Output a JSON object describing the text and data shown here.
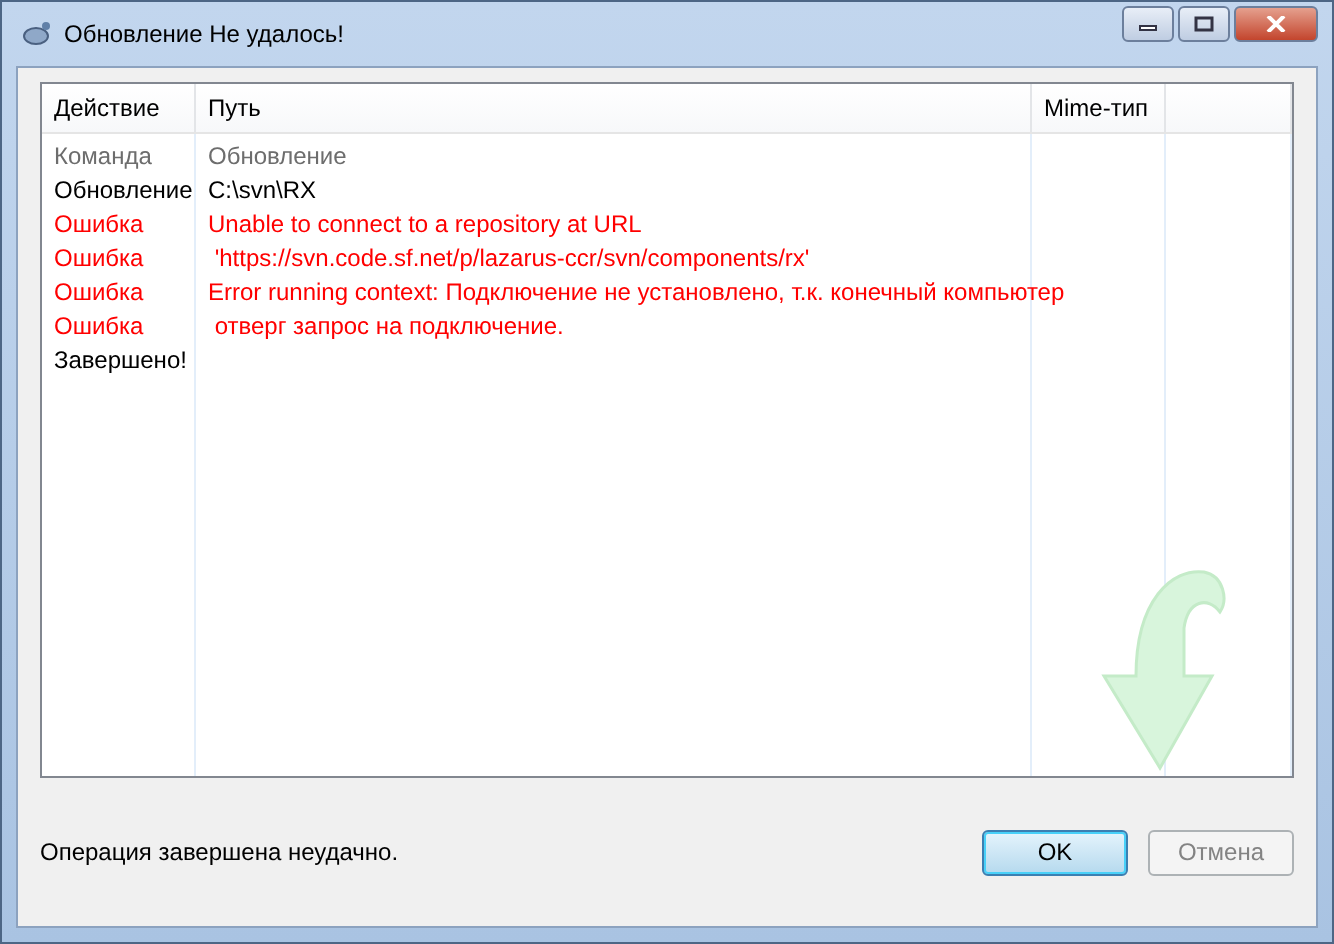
{
  "window": {
    "title": "Обновление Не удалось!"
  },
  "table": {
    "columns": [
      "Действие",
      "Путь",
      "Mime-тип"
    ],
    "rows": [
      {
        "kind": "command",
        "action": "Команда",
        "path": "Обновление"
      },
      {
        "kind": "normal",
        "action": "Обновление",
        "path": "C:\\svn\\RX"
      },
      {
        "kind": "error",
        "action": "Ошибка",
        "path": "Unable to connect to a repository at URL"
      },
      {
        "kind": "error",
        "action": "Ошибка",
        "path": " 'https://svn.code.sf.net/p/lazarus-ccr/svn/components/rx'"
      },
      {
        "kind": "error",
        "action": "Ошибка",
        "path": "Error running context: Подключение не установлено, т.к. конечный компьютер"
      },
      {
        "kind": "error",
        "action": "Ошибка",
        "path": " отверг запрос на подключение."
      },
      {
        "kind": "normal",
        "action": "Завершено!"
      }
    ]
  },
  "status": "Операция завершена неудачно.",
  "buttons": [
    {
      "label": "OK",
      "default": true,
      "disabled": false
    },
    {
      "label": "Отмена",
      "default": false,
      "disabled": true
    }
  ]
}
